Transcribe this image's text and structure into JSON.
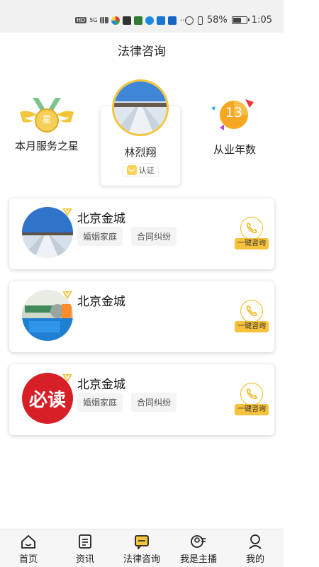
{
  "status_bar": {
    "hd": "HD",
    "network": "5G",
    "more": "···",
    "battery_percent": "58%",
    "battery_level": 0.58,
    "time": "1:05"
  },
  "header": {
    "title": "法律咨询"
  },
  "featured": {
    "star_badge_text": "星",
    "star_label": "本月服务之星",
    "name": "林烈翔",
    "verify_label": "认证",
    "years_value": "13",
    "years_label": "从业年数"
  },
  "lawyers": [
    {
      "name": "北京金城",
      "tags": [
        "婚姻家庭",
        "合同纠纷"
      ],
      "consult_label": "一键咨询"
    },
    {
      "name": "北京金城",
      "tags": [],
      "consult_label": "一键咨询"
    },
    {
      "name": "北京金城",
      "tags": [
        "婚姻家庭",
        "合同纠纷"
      ],
      "consult_label": "一键咨询",
      "avatar_text": "必读"
    }
  ],
  "bottom_nav": [
    {
      "label": "首页",
      "icon": "home-icon"
    },
    {
      "label": "资讯",
      "icon": "news-icon"
    },
    {
      "label": "法律咨询",
      "icon": "chat-icon",
      "active": true
    },
    {
      "label": "我是主播",
      "icon": "anchor-icon"
    },
    {
      "label": "我的",
      "icon": "profile-icon"
    }
  ],
  "colors": {
    "accent": "#f3c53b",
    "status_bg": "#f1f1f1",
    "nav_bg": "#f6f6f6"
  }
}
